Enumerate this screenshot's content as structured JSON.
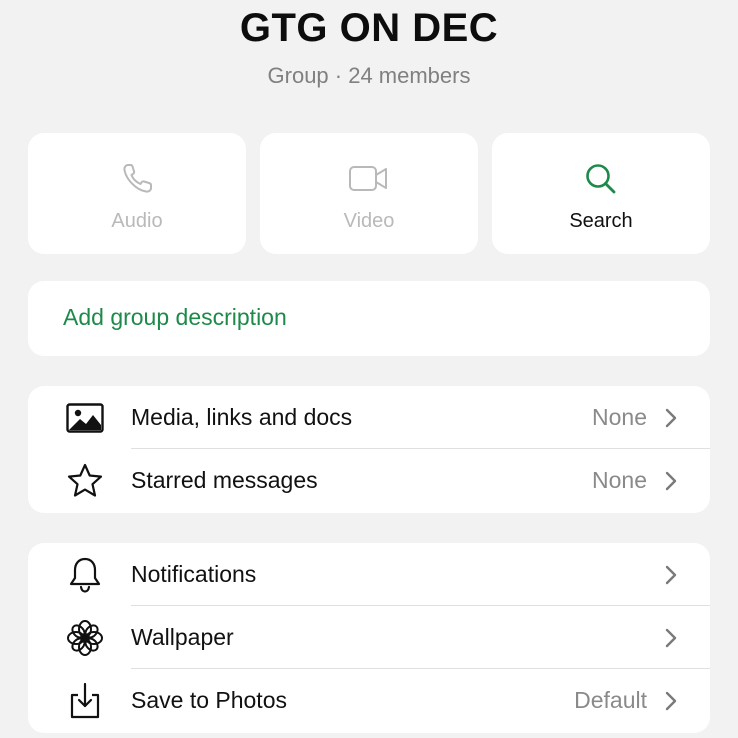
{
  "header": {
    "title": "GTG ON DEC",
    "subtitle": "Group · 24 members"
  },
  "actions": [
    {
      "label": "Audio",
      "icon": "phone-icon",
      "enabled": false
    },
    {
      "label": "Video",
      "icon": "video-camera-icon",
      "enabled": false
    },
    {
      "label": "Search",
      "icon": "search-icon",
      "enabled": true
    }
  ],
  "description": {
    "label": "Add group description"
  },
  "section1": {
    "rows": [
      {
        "label": "Media, links and docs",
        "value": "None",
        "icon": "image-icon"
      },
      {
        "label": "Starred messages",
        "value": "None",
        "icon": "star-icon"
      }
    ]
  },
  "section2": {
    "rows": [
      {
        "label": "Notifications",
        "value": "",
        "icon": "bell-icon"
      },
      {
        "label": "Wallpaper",
        "value": "",
        "icon": "flower-icon"
      },
      {
        "label": "Save to Photos",
        "value": "Default",
        "icon": "save-download-icon"
      }
    ]
  },
  "colors": {
    "accent": "#1d8a4a",
    "background": "#f2f2f2",
    "card": "#ffffff",
    "muted_text": "#8a8a8a",
    "disabled_text": "#b9b9b9"
  }
}
